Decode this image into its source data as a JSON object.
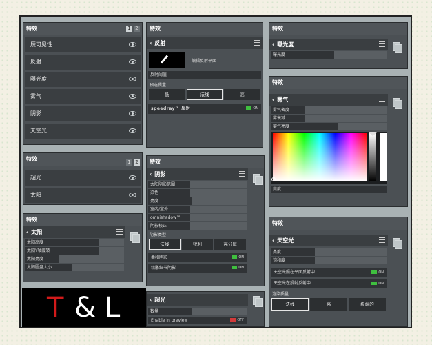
{
  "effects_panel_1": {
    "title": "特效",
    "pages": [
      "1",
      "2"
    ],
    "items": [
      "辰可见性",
      "反射",
      "曝光度",
      "雾气",
      "阴影",
      "天空光"
    ]
  },
  "effects_panel_2": {
    "title": "特效",
    "pages": [
      "1",
      "2"
    ],
    "items": [
      "超光",
      "太阳"
    ]
  },
  "reflection_panel": {
    "title": "特效",
    "header": "反射",
    "edit_label": "编辑反射平面",
    "threshold_label": "反射阈值",
    "quality_label": "预选质量",
    "quality_options": [
      "低",
      "法线",
      "高"
    ],
    "speedray_label": "speedray™ 反射",
    "speedray_state": "ON"
  },
  "exposure_panel": {
    "title": "特效",
    "header": "曝光度",
    "rows": [
      {
        "label": "曝光度",
        "level": 0.55
      }
    ]
  },
  "fog_panel": {
    "title": "特效",
    "header": "雾气",
    "rows": [
      {
        "label": "雾气密度",
        "level": 0.3
      },
      {
        "label": "雾衰减",
        "level": 0.3
      },
      {
        "label": "雾气亮度",
        "level": 0.58
      }
    ],
    "brightness_label": "亮度"
  },
  "shadow_panel": {
    "title": "特效",
    "header": "阴影",
    "rows": [
      {
        "label": "太阳阴影范围",
        "level": 0.43
      },
      {
        "label": "染色",
        "level": 0.43
      },
      {
        "label": "亮度",
        "level": 0.45
      },
      {
        "label": "室内/室外",
        "level": 0.43
      },
      {
        "label": "omnishadow™",
        "level": 0.43
      },
      {
        "label": "阴影校正",
        "level": 0.43
      }
    ],
    "type_label": "阴影类型",
    "type_options": [
      "法线",
      "锐利",
      "高分屏"
    ],
    "soft_label": "柔和阴影",
    "soft_state": "ON",
    "fine_label": "精雕细节阴影",
    "fine_state": "ON"
  },
  "sun_panel": {
    "title": "特效",
    "header": "太阳",
    "rows": [
      {
        "label": "太阳高度",
        "level": 0.75
      },
      {
        "label": "太阳Y轴旋转",
        "level": 0.75
      },
      {
        "label": "太阳亮度",
        "level": 0.35
      },
      {
        "label": "太阳圆盘大小",
        "level": 0.48
      }
    ]
  },
  "bloom_panel": {
    "header": "超光",
    "rows": [
      {
        "label": "数量",
        "level": 0.45
      }
    ],
    "preview_label": "Enable in preview",
    "preview_state": "OFF"
  },
  "sky_panel": {
    "title": "特效",
    "header": "天空光",
    "rows": [
      {
        "label": "亮度",
        "level": 0.38
      },
      {
        "label": "饱和度",
        "level": 0.38
      }
    ],
    "plane_label": "天空光照在平面反射中",
    "plane_state": "ON",
    "proj_label": "天空光在投射反射中",
    "proj_state": "ON",
    "quality_label": "渲染质量",
    "quality_options": [
      "法线",
      "高",
      "极端的"
    ]
  },
  "logo": {
    "t": "T",
    "amp": "&",
    "l": "L"
  },
  "colors": {
    "accent_red": "#d11a1a",
    "toggle_on": "#3fbf3f",
    "toggle_off": "#d23a3a"
  }
}
